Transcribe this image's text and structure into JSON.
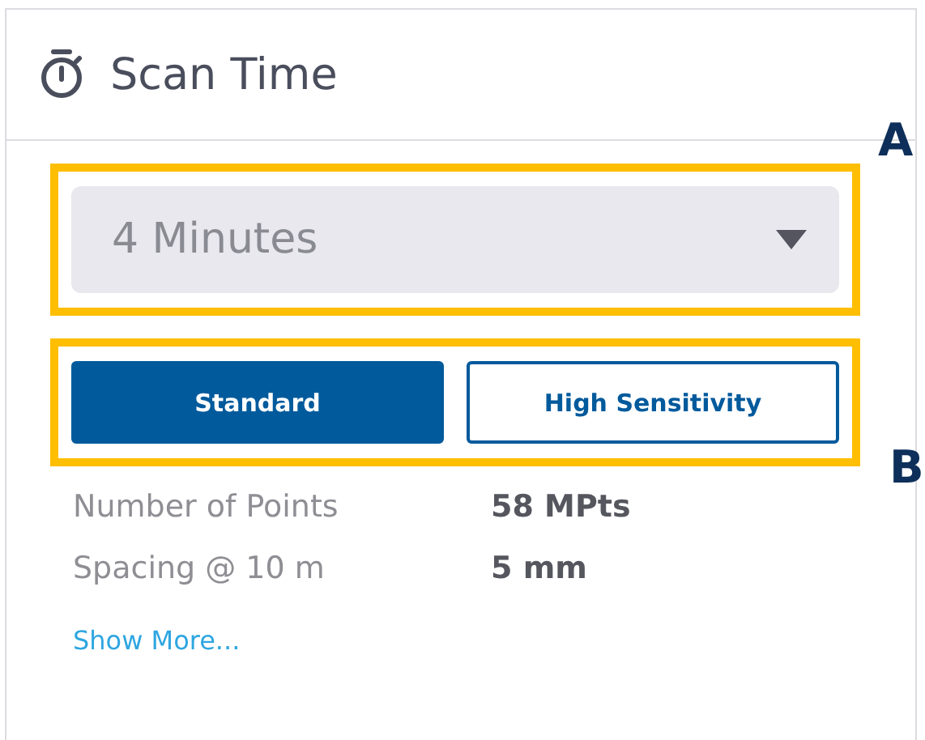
{
  "panel": {
    "title": "Scan Time"
  },
  "scan_time_select": {
    "value": "4 Minutes"
  },
  "modes": [
    {
      "label": "Standard",
      "selected": true
    },
    {
      "label": "High Sensitivity",
      "selected": false
    }
  ],
  "details": [
    {
      "label": "Number of Points",
      "value": "58 MPts"
    },
    {
      "label": "Spacing @ 10 m",
      "value": "5 mm"
    }
  ],
  "show_more": "Show More...",
  "callouts": [
    "A",
    "B"
  ]
}
